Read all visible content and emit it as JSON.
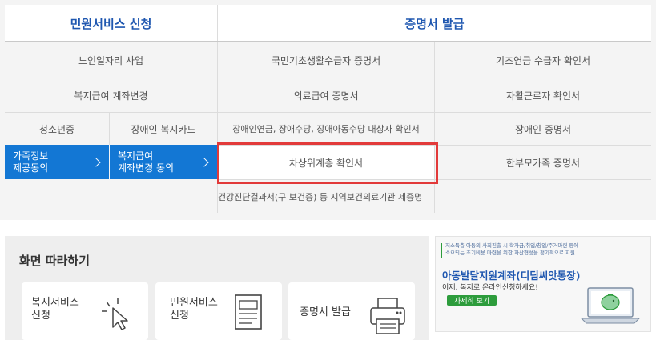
{
  "top_section": {
    "left_header": "민원서비스 신청",
    "right_header": "증명서 발급",
    "left_rows": [
      {
        "label": "노인일자리 사업"
      },
      {
        "label": "복지급여 계좌변경"
      }
    ],
    "left_row3": {
      "a": "청소년증",
      "b": "장애인 복지카드"
    },
    "blue_buttons": [
      {
        "line1": "가족정보",
        "line2": "제공동의"
      },
      {
        "line1": "복지급여",
        "line2": "계좌변경 동의"
      }
    ],
    "cert_rows": [
      {
        "col1": "국민기초생활수급자 증명서",
        "col2": "기초연금 수급자 확인서"
      },
      {
        "col1": "의료급여 증명서",
        "col2": "자활근로자 확인서"
      },
      {
        "col1": "장애인연금, 장애수당, 장애아동수당 대상자 확인서",
        "col2": "장애인 증명서"
      },
      {
        "col1": "차상위계층 확인서",
        "col2": "한부모가족 증명서"
      },
      {
        "col1": "건강진단결과서(구 보건증) 등 지역보건의료기관 제증명",
        "col2": ""
      }
    ],
    "highlight_color": "#e23a3a",
    "header_accent": "#1f57b0",
    "blue_button_color": "#1377d4"
  },
  "guide_section": {
    "title": "화면 따라하기",
    "cards": [
      {
        "line1": "복지서비스",
        "line2": "신청",
        "icon": "cursor-click-icon"
      },
      {
        "line1": "민원서비스",
        "line2": "신청",
        "icon": "document-icon"
      },
      {
        "line1": "증명서 발급",
        "line2": "",
        "icon": "printer-icon"
      }
    ]
  },
  "banner": {
    "top_text_1": "저소득층 아동의 사회진출 시 학자금/취업/창업/주거마련 등에",
    "top_text_2": "소요되는 초기비용 마련을 위한 자산형성을 정기적으로 지원",
    "title": "아동발달지원계좌(디딤씨앗통장)",
    "subtitle": "이제, 복지로 온라인신청하세요!",
    "button": "자세히 보기",
    "icon": "laptop-piggy-icon"
  }
}
